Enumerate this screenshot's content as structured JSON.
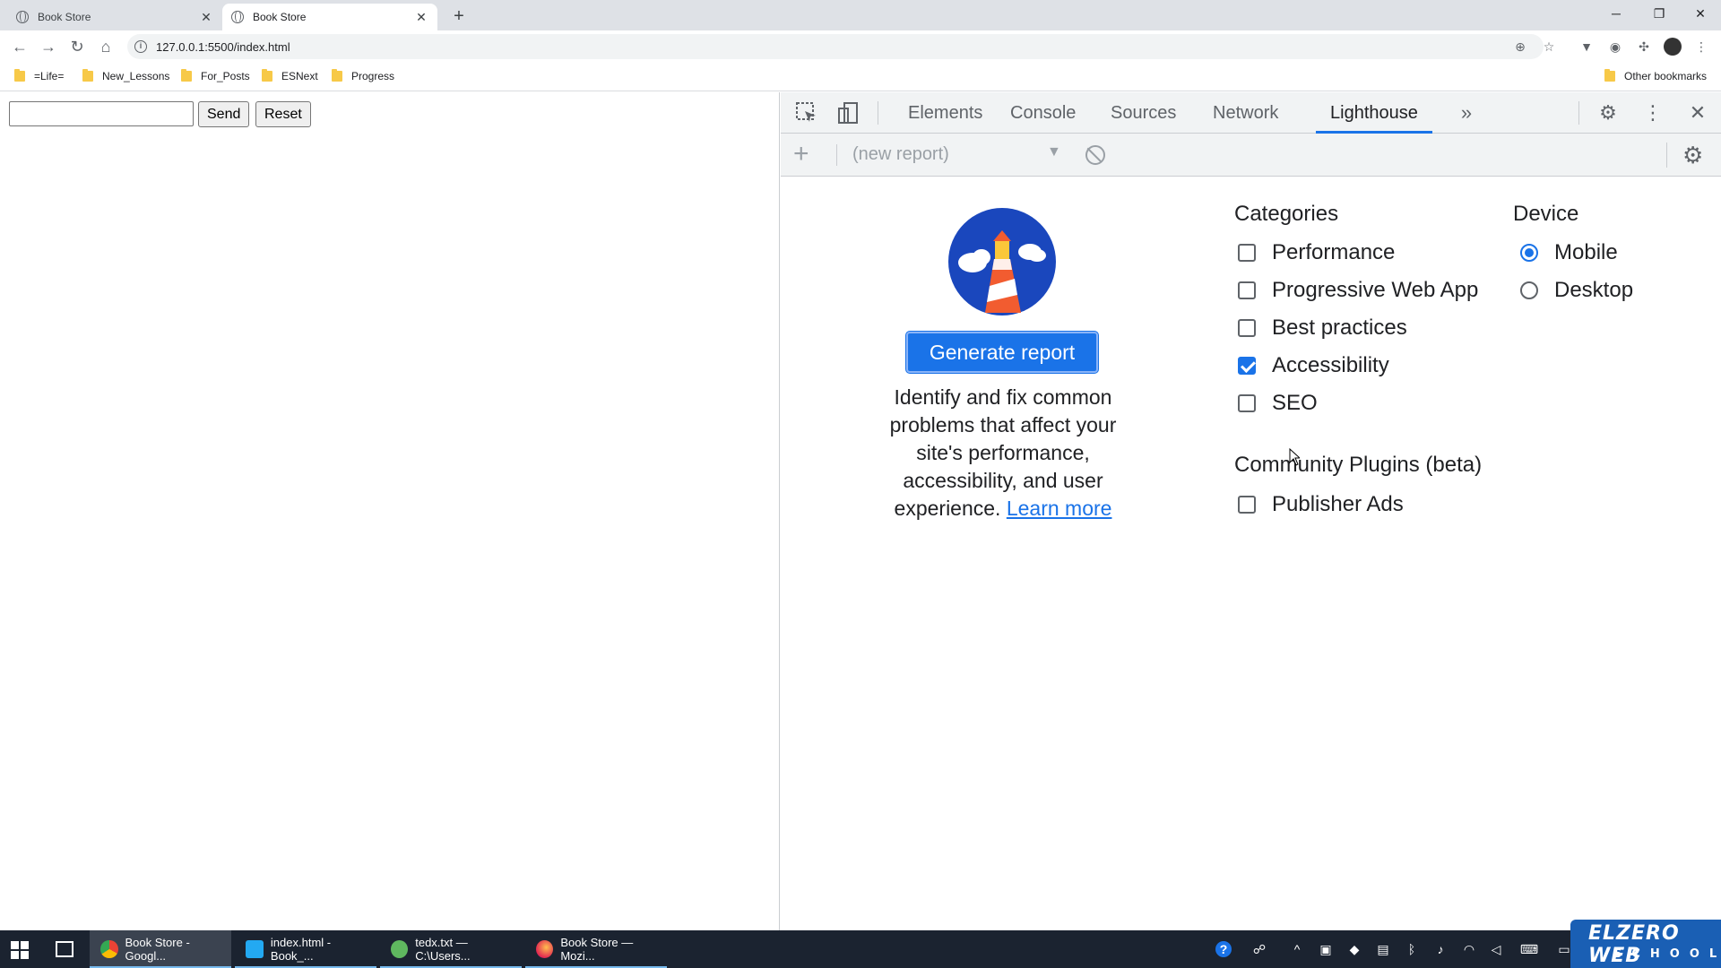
{
  "browser": {
    "tabs": [
      {
        "title": "Book Store",
        "active": false
      },
      {
        "title": "Book Store",
        "active": true
      }
    ],
    "new_tab": "+",
    "window_controls": {
      "minimize": "─",
      "restore": "❐",
      "close": "✕"
    },
    "url": "127.0.0.1:5500/index.html",
    "bookmarks": [
      "=Life=",
      "New_Lessons",
      "For_Posts",
      "ESNext",
      "Progress"
    ],
    "other_bookmarks": "Other bookmarks"
  },
  "page": {
    "input_value": "",
    "send_label": "Send",
    "reset_label": "Reset"
  },
  "devtools": {
    "tabs": [
      "Elements",
      "Console",
      "Sources",
      "Network",
      "Lighthouse"
    ],
    "active_tab": "Lighthouse",
    "more_tabs": "»",
    "report_select": "(new report)",
    "generate_label": "Generate report",
    "intro_text": "Identify and fix common problems that affect your site's performance, accessibility, and user experience.",
    "learn_more": "Learn more",
    "categories_title": "Categories",
    "categories": [
      {
        "label": "Performance",
        "checked": false
      },
      {
        "label": "Progressive Web App",
        "checked": false
      },
      {
        "label": "Best practices",
        "checked": false
      },
      {
        "label": "Accessibility",
        "checked": true
      },
      {
        "label": "SEO",
        "checked": false
      }
    ],
    "device_title": "Device",
    "devices": [
      {
        "label": "Mobile",
        "selected": true
      },
      {
        "label": "Desktop",
        "selected": false
      }
    ],
    "plugins_title": "Community Plugins (beta)",
    "plugins": [
      {
        "label": "Publisher Ads",
        "checked": false
      }
    ]
  },
  "taskbar": {
    "apps": [
      {
        "label": "Book Store - Googl...",
        "icon": "chrome-icon",
        "active": true
      },
      {
        "label": "index.html - Book_...",
        "icon": "vscode-icon",
        "active": false
      },
      {
        "label": "tedx.txt — C:\\Users...",
        "icon": "notepad-icon",
        "active": false
      },
      {
        "label": "Book Store — Mozi...",
        "icon": "firefox-icon",
        "active": false
      }
    ],
    "brand_line1": "ELZERO WEB",
    "brand_line2": "SCHOOL"
  },
  "colors": {
    "accent": "#1a73e8",
    "devtools_bg": "#f1f3f4",
    "taskbar_bg": "#1b2330"
  }
}
